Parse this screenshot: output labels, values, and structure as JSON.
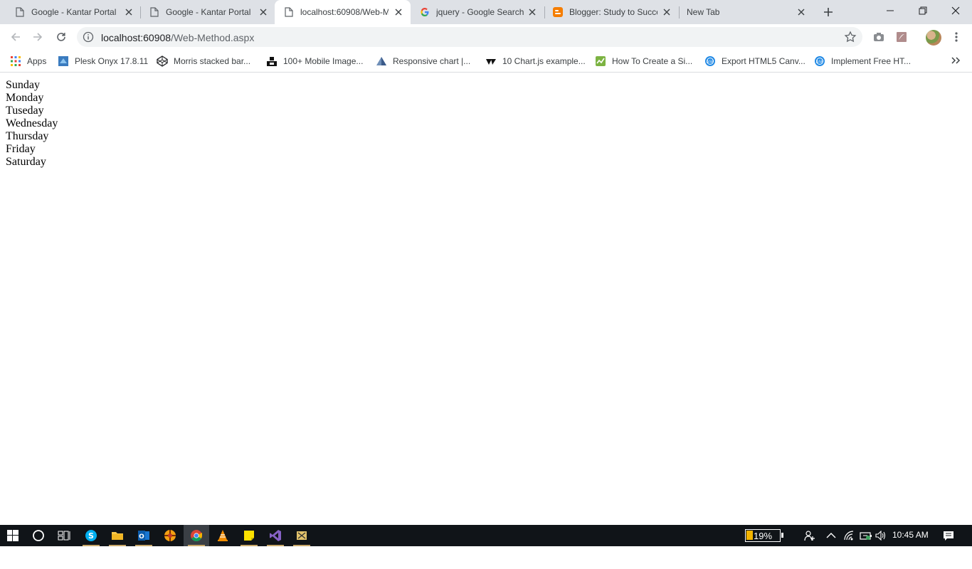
{
  "tabs": [
    {
      "title": "Google - Kantar Portal",
      "icon": "page-icon",
      "active": false
    },
    {
      "title": "Google - Kantar Portal",
      "icon": "page-icon",
      "active": false
    },
    {
      "title": "localhost:60908/Web-M",
      "icon": "page-icon",
      "active": true
    },
    {
      "title": "jquery - Google Search",
      "icon": "google-icon",
      "active": false
    },
    {
      "title": "Blogger: Study to Succe",
      "icon": "blogger-icon",
      "active": false
    },
    {
      "title": "New Tab",
      "icon": "none",
      "active": false
    }
  ],
  "address_bar": {
    "host": "localhost:60908",
    "path": "/Web-Method.aspx"
  },
  "bookmarks": [
    {
      "label": "Apps",
      "icon": "apps-grid-icon"
    },
    {
      "label": "Plesk Onyx 17.8.11",
      "icon": "plesk-icon"
    },
    {
      "label": "Morris stacked bar...",
      "icon": "codepen-icon"
    },
    {
      "label": "100+ Mobile Image...",
      "icon": "unsplash-icon"
    },
    {
      "label": "Responsive chart |...",
      "icon": "chart-site-icon"
    },
    {
      "label": "10 Chart.js example...",
      "icon": "tutorial-site-icon"
    },
    {
      "label": "How To Create a Si...",
      "icon": "graph-site-icon"
    },
    {
      "label": "Export HTML5 Canv...",
      "icon": "asp-site-icon"
    },
    {
      "label": "Implement Free HT...",
      "icon": "asp-site-icon"
    }
  ],
  "page": {
    "days": [
      "Sunday",
      "Monday",
      "Tuseday",
      "Wednesday",
      "Thursday",
      "Friday",
      "Saturday"
    ]
  },
  "taskbar": {
    "battery_percent": "19%",
    "time": "10:45 AM",
    "apps": [
      "skype",
      "file-explorer",
      "outlook",
      "app-orange",
      "chrome",
      "vlc",
      "sticky-notes",
      "visual-studio",
      "app-tools"
    ]
  },
  "colors": {
    "tabstrip": "#dee1e6",
    "taskbar": "#101418",
    "battery_fill": "#f3b400"
  }
}
